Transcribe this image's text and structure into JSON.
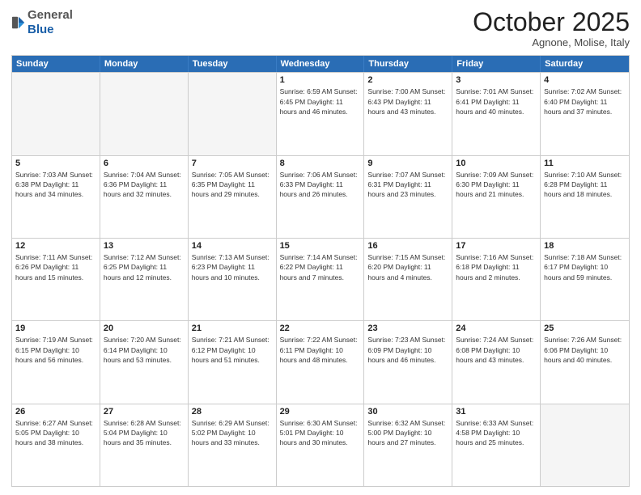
{
  "logo": {
    "general": "General",
    "blue": "Blue"
  },
  "header": {
    "month": "October 2025",
    "location": "Agnone, Molise, Italy"
  },
  "days": [
    "Sunday",
    "Monday",
    "Tuesday",
    "Wednesday",
    "Thursday",
    "Friday",
    "Saturday"
  ],
  "weeks": [
    [
      {
        "day": "",
        "info": ""
      },
      {
        "day": "",
        "info": ""
      },
      {
        "day": "",
        "info": ""
      },
      {
        "day": "1",
        "info": "Sunrise: 6:59 AM\nSunset: 6:45 PM\nDaylight: 11 hours\nand 46 minutes."
      },
      {
        "day": "2",
        "info": "Sunrise: 7:00 AM\nSunset: 6:43 PM\nDaylight: 11 hours\nand 43 minutes."
      },
      {
        "day": "3",
        "info": "Sunrise: 7:01 AM\nSunset: 6:41 PM\nDaylight: 11 hours\nand 40 minutes."
      },
      {
        "day": "4",
        "info": "Sunrise: 7:02 AM\nSunset: 6:40 PM\nDaylight: 11 hours\nand 37 minutes."
      }
    ],
    [
      {
        "day": "5",
        "info": "Sunrise: 7:03 AM\nSunset: 6:38 PM\nDaylight: 11 hours\nand 34 minutes."
      },
      {
        "day": "6",
        "info": "Sunrise: 7:04 AM\nSunset: 6:36 PM\nDaylight: 11 hours\nand 32 minutes."
      },
      {
        "day": "7",
        "info": "Sunrise: 7:05 AM\nSunset: 6:35 PM\nDaylight: 11 hours\nand 29 minutes."
      },
      {
        "day": "8",
        "info": "Sunrise: 7:06 AM\nSunset: 6:33 PM\nDaylight: 11 hours\nand 26 minutes."
      },
      {
        "day": "9",
        "info": "Sunrise: 7:07 AM\nSunset: 6:31 PM\nDaylight: 11 hours\nand 23 minutes."
      },
      {
        "day": "10",
        "info": "Sunrise: 7:09 AM\nSunset: 6:30 PM\nDaylight: 11 hours\nand 21 minutes."
      },
      {
        "day": "11",
        "info": "Sunrise: 7:10 AM\nSunset: 6:28 PM\nDaylight: 11 hours\nand 18 minutes."
      }
    ],
    [
      {
        "day": "12",
        "info": "Sunrise: 7:11 AM\nSunset: 6:26 PM\nDaylight: 11 hours\nand 15 minutes."
      },
      {
        "day": "13",
        "info": "Sunrise: 7:12 AM\nSunset: 6:25 PM\nDaylight: 11 hours\nand 12 minutes."
      },
      {
        "day": "14",
        "info": "Sunrise: 7:13 AM\nSunset: 6:23 PM\nDaylight: 11 hours\nand 10 minutes."
      },
      {
        "day": "15",
        "info": "Sunrise: 7:14 AM\nSunset: 6:22 PM\nDaylight: 11 hours\nand 7 minutes."
      },
      {
        "day": "16",
        "info": "Sunrise: 7:15 AM\nSunset: 6:20 PM\nDaylight: 11 hours\nand 4 minutes."
      },
      {
        "day": "17",
        "info": "Sunrise: 7:16 AM\nSunset: 6:18 PM\nDaylight: 11 hours\nand 2 minutes."
      },
      {
        "day": "18",
        "info": "Sunrise: 7:18 AM\nSunset: 6:17 PM\nDaylight: 10 hours\nand 59 minutes."
      }
    ],
    [
      {
        "day": "19",
        "info": "Sunrise: 7:19 AM\nSunset: 6:15 PM\nDaylight: 10 hours\nand 56 minutes."
      },
      {
        "day": "20",
        "info": "Sunrise: 7:20 AM\nSunset: 6:14 PM\nDaylight: 10 hours\nand 53 minutes."
      },
      {
        "day": "21",
        "info": "Sunrise: 7:21 AM\nSunset: 6:12 PM\nDaylight: 10 hours\nand 51 minutes."
      },
      {
        "day": "22",
        "info": "Sunrise: 7:22 AM\nSunset: 6:11 PM\nDaylight: 10 hours\nand 48 minutes."
      },
      {
        "day": "23",
        "info": "Sunrise: 7:23 AM\nSunset: 6:09 PM\nDaylight: 10 hours\nand 46 minutes."
      },
      {
        "day": "24",
        "info": "Sunrise: 7:24 AM\nSunset: 6:08 PM\nDaylight: 10 hours\nand 43 minutes."
      },
      {
        "day": "25",
        "info": "Sunrise: 7:26 AM\nSunset: 6:06 PM\nDaylight: 10 hours\nand 40 minutes."
      }
    ],
    [
      {
        "day": "26",
        "info": "Sunrise: 6:27 AM\nSunset: 5:05 PM\nDaylight: 10 hours\nand 38 minutes."
      },
      {
        "day": "27",
        "info": "Sunrise: 6:28 AM\nSunset: 5:04 PM\nDaylight: 10 hours\nand 35 minutes."
      },
      {
        "day": "28",
        "info": "Sunrise: 6:29 AM\nSunset: 5:02 PM\nDaylight: 10 hours\nand 33 minutes."
      },
      {
        "day": "29",
        "info": "Sunrise: 6:30 AM\nSunset: 5:01 PM\nDaylight: 10 hours\nand 30 minutes."
      },
      {
        "day": "30",
        "info": "Sunrise: 6:32 AM\nSunset: 5:00 PM\nDaylight: 10 hours\nand 27 minutes."
      },
      {
        "day": "31",
        "info": "Sunrise: 6:33 AM\nSunset: 4:58 PM\nDaylight: 10 hours\nand 25 minutes."
      },
      {
        "day": "",
        "info": ""
      }
    ]
  ]
}
